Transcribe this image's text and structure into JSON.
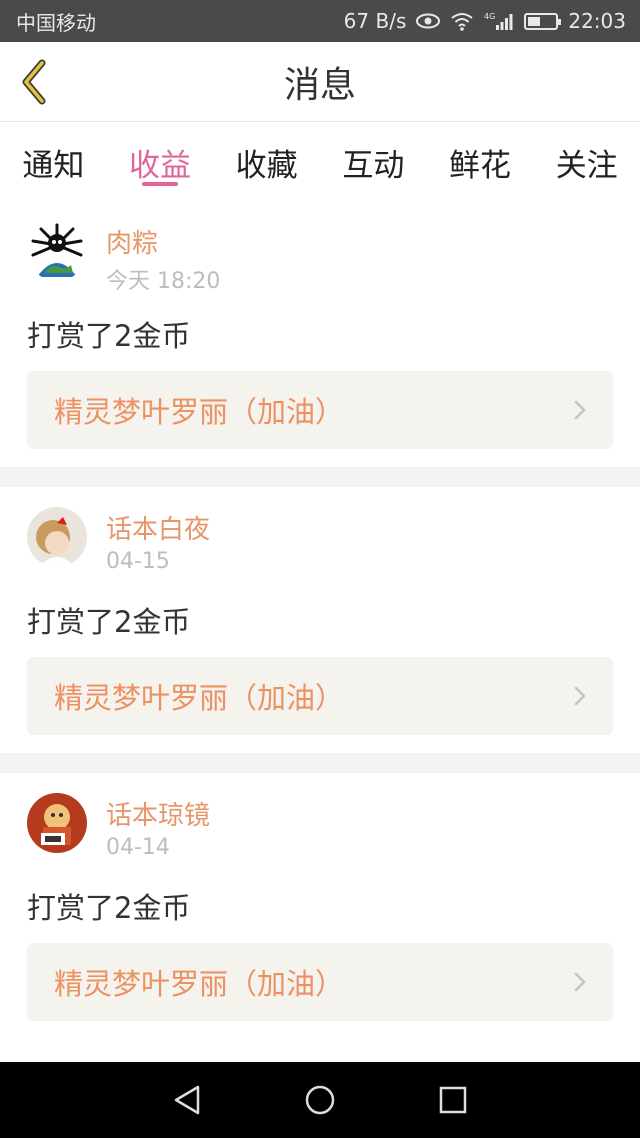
{
  "status_bar": {
    "carrier": "中国移动",
    "net_speed": "67 B/s",
    "network": "4G",
    "time": "22:03"
  },
  "header": {
    "title": "消息"
  },
  "tabs": [
    {
      "label": "通知",
      "active": false
    },
    {
      "label": "收益",
      "active": true
    },
    {
      "label": "收藏",
      "active": false
    },
    {
      "label": "互动",
      "active": false
    },
    {
      "label": "鲜花",
      "active": false
    },
    {
      "label": "关注",
      "active": false
    }
  ],
  "messages": [
    {
      "username": "肉粽",
      "time": "今天 18:20",
      "text": "打赏了2金币",
      "link": "精灵梦叶罗丽（加油）",
      "avatar": "spiky-globe-avatar"
    },
    {
      "username": "话本白夜",
      "time": "04-15",
      "text": "打赏了2金币",
      "link": "精灵梦叶罗丽（加油）",
      "avatar": "doll-avatar"
    },
    {
      "username": "话本琼镜",
      "time": "04-14",
      "text": "打赏了2金币",
      "link": "精灵梦叶罗丽（加油）",
      "avatar": "cartoon-avatar"
    }
  ],
  "colors": {
    "accent": "#e0679b",
    "username": "#e8956a",
    "link_text": "#ec9161",
    "link_bg": "#f5f3ee",
    "back_arrow": "#c9a227"
  }
}
